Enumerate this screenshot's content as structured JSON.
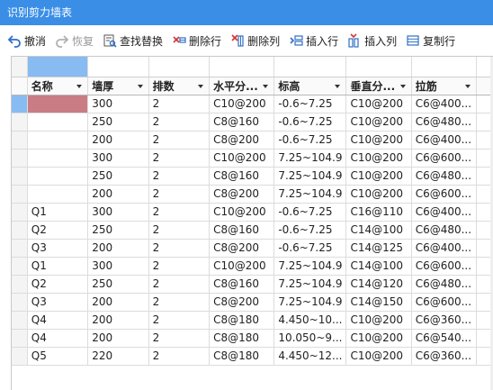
{
  "window": {
    "title": "识别剪力墙表"
  },
  "toolbar": {
    "undo": "撤消",
    "redo": "恢复",
    "find_replace": "查找替换",
    "delete_row": "删除行",
    "delete_col": "删除列",
    "insert_row": "插入行",
    "insert_col": "插入列",
    "copy_row": "复制行"
  },
  "table": {
    "headers": [
      "名称",
      "墙厚",
      "排数",
      "水平分...",
      "标高",
      "垂直分...",
      "拉筋"
    ],
    "rows": [
      [
        "",
        "300",
        "2",
        "C10@200",
        "-0.6~7.25",
        "C10@200",
        "C6@400..."
      ],
      [
        "",
        "250",
        "2",
        "C8@160",
        "-0.6~7.25",
        "C10@200",
        "C6@480..."
      ],
      [
        "",
        "200",
        "2",
        "C8@200",
        "-0.6~7.25",
        "C10@200",
        "C6@400..."
      ],
      [
        "",
        "300",
        "2",
        "C10@200",
        "7.25~104.9",
        "C10@200",
        "C6@600..."
      ],
      [
        "",
        "250",
        "2",
        "C8@160",
        "7.25~104.9",
        "C10@200",
        "C6@480..."
      ],
      [
        "",
        "200",
        "2",
        "C8@200",
        "7.25~104.9",
        "C10@200",
        "C6@600..."
      ],
      [
        "Q1",
        "300",
        "2",
        "C10@200",
        "-0.6~7.25",
        "C16@110",
        "C6@400..."
      ],
      [
        "Q2",
        "250",
        "2",
        "C8@160",
        "-0.6~7.25",
        "C14@100",
        "C6@480..."
      ],
      [
        "Q3",
        "200",
        "2",
        "C8@200",
        "-0.6~7.25",
        "C14@125",
        "C6@400..."
      ],
      [
        "Q1",
        "300",
        "2",
        "C10@200",
        "7.25~104.9",
        "C14@100",
        "C6@600..."
      ],
      [
        "Q2",
        "250",
        "2",
        "C8@160",
        "7.25~104.9",
        "C14@120",
        "C6@480..."
      ],
      [
        "Q3",
        "200",
        "2",
        "C8@200",
        "7.25~104.9",
        "C14@150",
        "C6@600..."
      ],
      [
        "Q4",
        "200",
        "2",
        "C8@180",
        "4.450~10...",
        "C10@200",
        "C6@360..."
      ],
      [
        "Q4",
        "200",
        "2",
        "C8@180",
        "10.050~9...",
        "C10@200",
        "C6@540..."
      ],
      [
        "Q5",
        "220",
        "2",
        "C8@180",
        "4.450~12...",
        "C10@200",
        "C6@360..."
      ]
    ]
  },
  "colors": {
    "titlebar": "#3a8ee6",
    "selection": "#88bbf2",
    "active_cell": "#c97c84"
  }
}
